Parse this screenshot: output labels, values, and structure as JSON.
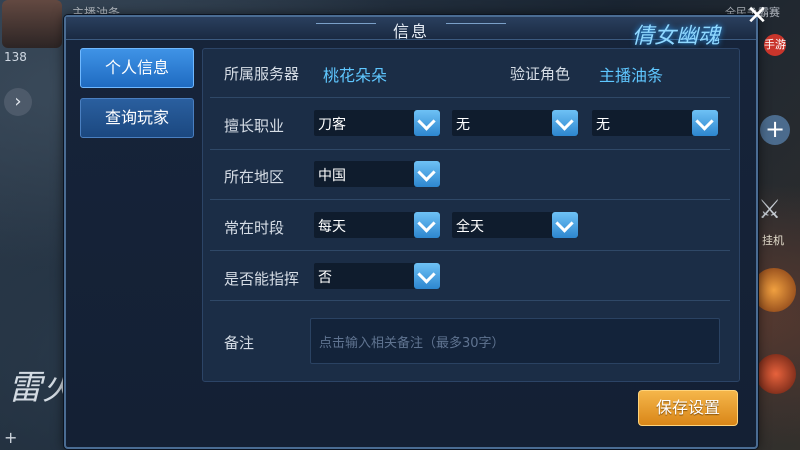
{
  "background": {
    "player_name": "主播油条",
    "level": "138",
    "match_label": "全民争霸赛",
    "auto_label": "挂机",
    "brand_calligraphy": "雷火"
  },
  "dialog": {
    "title": "信息",
    "logo_text": "倩女幽魂",
    "logo_badge": "手游"
  },
  "tabs": [
    {
      "label": "个人信息",
      "active": true
    },
    {
      "label": "查询玩家",
      "active": false
    }
  ],
  "form": {
    "server_label": "所属服务器",
    "server_value": "桃花朵朵",
    "role_label": "验证角色",
    "role_value": "主播油条",
    "profession_label": "擅长职业",
    "profession_values": [
      "刀客",
      "无",
      "无"
    ],
    "region_label": "所在地区",
    "region_value": "中国",
    "time_label": "常在时段",
    "time_values": [
      "每天",
      "全天"
    ],
    "command_label": "是否能指挥",
    "command_value": "否",
    "remark_label": "备注",
    "remark_placeholder": "点击输入相关备注（最多30字）"
  },
  "save_button": "保存设置",
  "colors": {
    "accent_blue": "#5fc7ff",
    "tab_active": "#2f80d6",
    "save_button": "#e99a2a"
  }
}
